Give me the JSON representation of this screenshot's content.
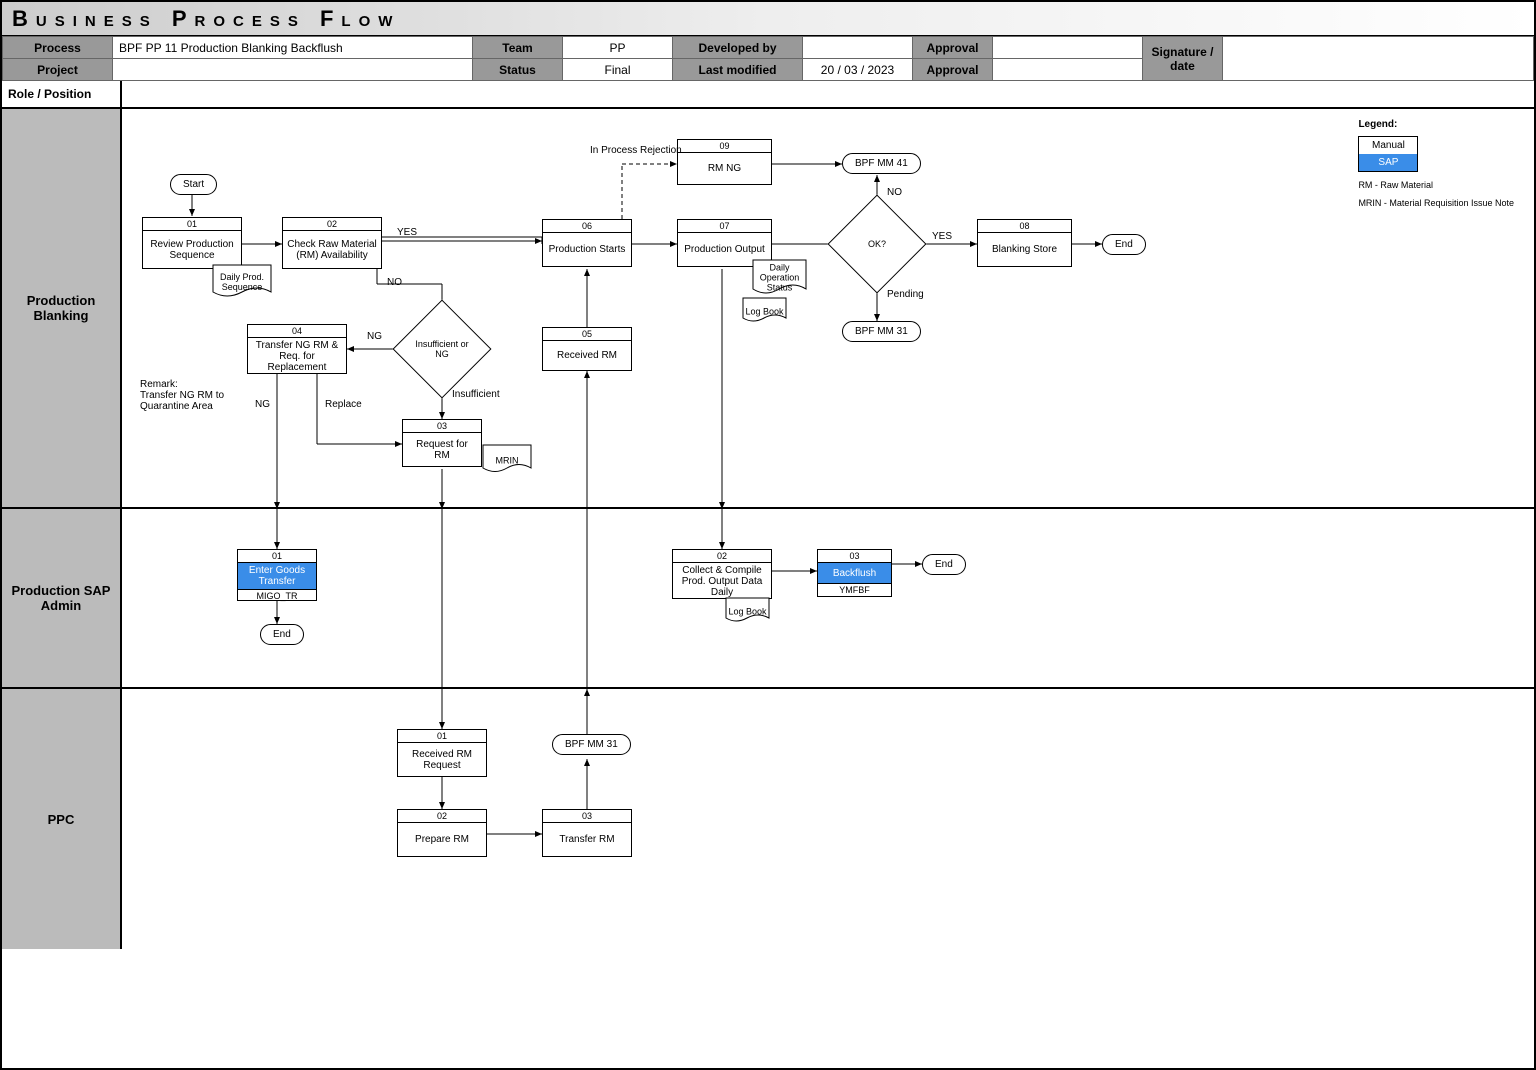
{
  "title": "Business Process Flow",
  "meta": {
    "process_label": "Process",
    "process_value": "BPF PP 11 Production Blanking Backflush",
    "team_label": "Team",
    "team_value": "PP",
    "developed_by_label": "Developed by",
    "developed_by_value": "",
    "approval_label": "Approval",
    "approval_value": "",
    "signature_label": "Signature / date",
    "signature_value": "",
    "project_label": "Project",
    "project_value": "",
    "status_label": "Status",
    "status_value": "Final",
    "last_modified_label": "Last modified",
    "last_modified_value": "20 / 03 / 2023",
    "approval2_label": "Approval",
    "approval2_value": ""
  },
  "header": {
    "role_label": "Role / Position"
  },
  "lanes": {
    "l1": "Production Blanking",
    "l2": "Production SAP Admin",
    "l3": "PPC"
  },
  "terminators": {
    "start": "Start",
    "end1": "End",
    "end2": "End",
    "end3": "End",
    "bpf_mm41": "BPF MM 41",
    "bpf_mm31_a": "BPF MM 31",
    "bpf_mm31_b": "BPF MM 31"
  },
  "nodes": {
    "n01": {
      "id": "01",
      "text": "Review Production Sequence"
    },
    "n02": {
      "id": "02",
      "text": "Check Raw Material (RM) Availability"
    },
    "n03": {
      "id": "03",
      "text": "Request for RM"
    },
    "n04": {
      "id": "04",
      "text": "Transfer  NG RM & Req. for Replacement"
    },
    "n05": {
      "id": "05",
      "text": "Received RM"
    },
    "n06": {
      "id": "06",
      "text": "Production Starts"
    },
    "n07": {
      "id": "07",
      "text": "Production Output"
    },
    "n08": {
      "id": "08",
      "text": "Blanking Store"
    },
    "n09": {
      "id": "09",
      "text": "RM NG"
    },
    "sap01": {
      "id": "01",
      "text": "Enter Goods Transfer",
      "code": "MIGO_TR"
    },
    "sap02": {
      "id": "02",
      "text": "Collect & Compile Prod. Output Data Daily"
    },
    "sap03": {
      "id": "03",
      "text": "Backflush",
      "code": "YMFBF"
    },
    "ppc01": {
      "id": "01",
      "text": "Received RM Request"
    },
    "ppc02": {
      "id": "02",
      "text": "Prepare RM"
    },
    "ppc03": {
      "id": "03",
      "text": "Transfer RM"
    }
  },
  "diamonds": {
    "d1": "Insufficient or NG",
    "d2": "OK?"
  },
  "docs": {
    "daily_seq": "Daily Prod. Sequence",
    "mrin": "MRIN",
    "daily_op": "Daily Operation Status",
    "log_book1": "Log Book",
    "log_book2": "Log Book"
  },
  "edge_labels": {
    "yes1": "YES",
    "no1": "NO",
    "ng": "NG",
    "insufficient": "Insufficient",
    "replace": "Replace",
    "ng2": "NG",
    "rejection": "In Process Rejection",
    "no2": "NO",
    "yes2": "YES",
    "pending": "Pending"
  },
  "remark": {
    "title": "Remark:",
    "text": "Transfer NG RM to Quarantine Area"
  },
  "legend": {
    "title": "Legend:",
    "manual": "Manual",
    "sap": "SAP",
    "note1": "RM - Raw Material",
    "note2": "MRIN - Material Requisition Issue Note"
  }
}
